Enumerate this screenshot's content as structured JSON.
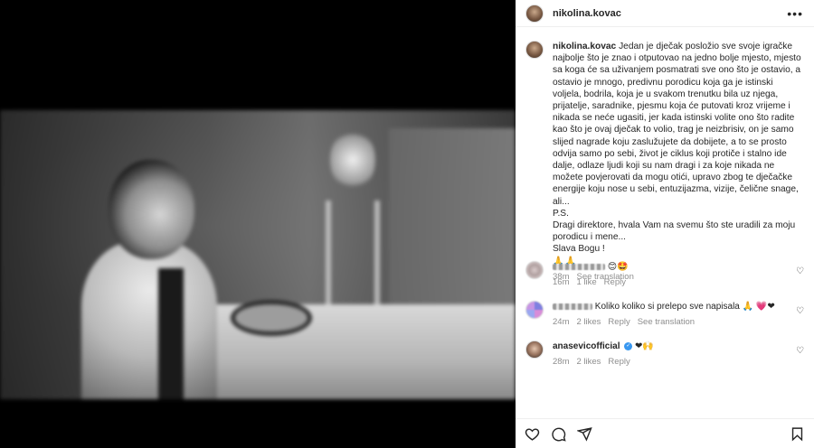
{
  "post": {
    "username": "nikolina.kovac",
    "more_icon": "more-horizontal-icon",
    "caption_username": "nikolina.kovac",
    "caption_text": "Jedan je dječak posložio sve svoje igračke najbolje što je znao i otputovao na jedno bolje mjesto, mjesto sa koga će sa uživanjem posmatrati sve ono što je ostavio, a ostavio je mnogo, predivnu porodicu koja ga je istinski voljela, bodrila, koja je u svakom trenutku bila uz njega, prijatelje, saradnike, pjesmu koja će putovati kroz vrijeme i nikada se neće ugasiti, jer kada istinski volite ono što radite kao što je ovaj dječak to volio, trag je neizbrisiv, on je samo slijed nagrade koju zaslužujete da dobijete, a to se prosto odvija samo po sebi, život je ciklus koji protiče i stalno ide dalje, odlaze ljudi koji su nam dragi i za koje nikada ne možete povjerovati da mogu otići, upravo zbog te dječačke energije koju nose u sebi, entuzijazma, vizije, čelične snage, ali...",
    "caption_ps": "P.S.",
    "caption_thanks": "Dragi direktore, hvala Vam na svemu što ste uradili za moju porodicu i mene...",
    "caption_slava": "Slava Bogu !",
    "caption_emoji": "🙏🙏",
    "caption_time": "38m",
    "see_translation": "See translation"
  },
  "comments": [
    {
      "username": "",
      "text": "😊🤩",
      "time": "16m",
      "likes": "1 like",
      "reply": "Reply"
    },
    {
      "username": "",
      "text": "Koliko koliko si prelepo sve napisala",
      "emoji_tail": "🙏 💗❤",
      "time": "24m",
      "likes": "2 likes",
      "reply": "Reply",
      "see_translation": "See translation"
    },
    {
      "username": "anasevicofficial",
      "text": "❤🙌",
      "time": "28m",
      "likes": "2 likes",
      "reply": "Reply"
    }
  ],
  "actions": {
    "like_icon": "heart-icon",
    "comment_icon": "comment-icon",
    "share_icon": "share-icon",
    "save_icon": "bookmark-icon"
  }
}
